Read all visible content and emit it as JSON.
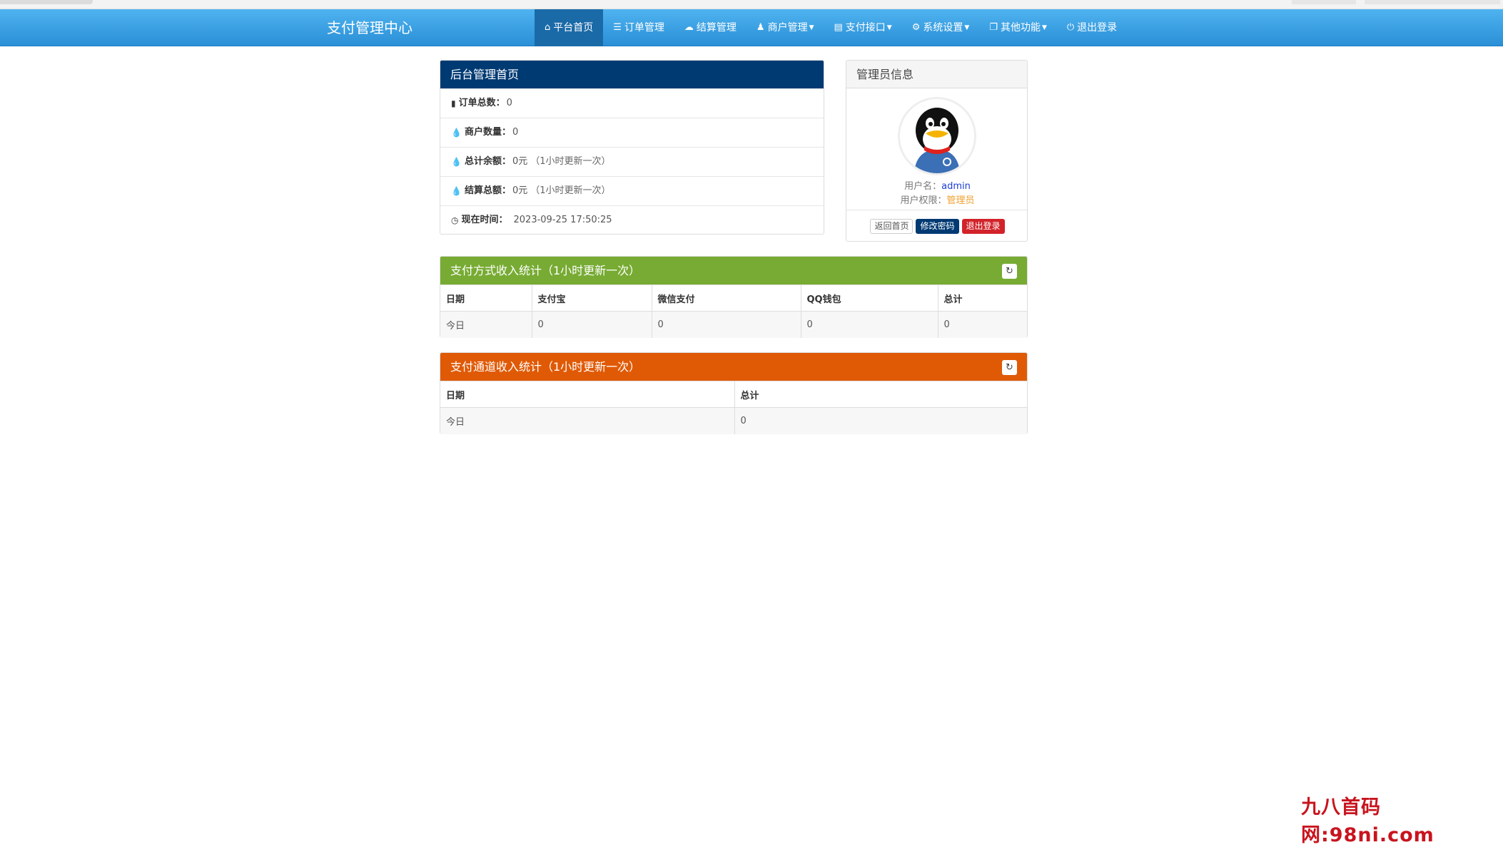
{
  "navbar": {
    "brand": "支付管理中心",
    "items": [
      {
        "label": "平台首页",
        "icon": "home-icon",
        "active": true
      },
      {
        "label": "订单管理",
        "icon": "list-icon"
      },
      {
        "label": "结算管理",
        "icon": "cloud-icon"
      },
      {
        "label": "商户管理",
        "icon": "user-icon",
        "dropdown": true
      },
      {
        "label": "支付接口",
        "icon": "credit-card-icon",
        "dropdown": true
      },
      {
        "label": "系统设置",
        "icon": "gear-icon",
        "dropdown": true
      },
      {
        "label": "其他功能",
        "icon": "cube-icon",
        "dropdown": true
      },
      {
        "label": "退出登录",
        "icon": "power-icon"
      }
    ]
  },
  "home_panel": {
    "title": "后台管理首页",
    "rows": [
      {
        "icon": "bar-chart-icon",
        "label": "订单总数：",
        "value": "0",
        "note": ""
      },
      {
        "icon": "tint-icon",
        "label": "商户数量：",
        "value": "0",
        "note": ""
      },
      {
        "icon": "tint-icon",
        "label": "总计余额：",
        "value": "0元",
        "note": "（1小时更新一次）"
      },
      {
        "icon": "tint-icon",
        "label": "结算总额：",
        "value": "0元",
        "note": "（1小时更新一次）"
      },
      {
        "icon": "clock-icon",
        "label": "现在时间：",
        "value": "2023-09-25 17:50:25",
        "note": ""
      }
    ]
  },
  "admin_panel": {
    "title": "管理员信息",
    "username_label": "用户名：",
    "username": "admin",
    "role_label": "用户权限：",
    "role": "管理员",
    "buttons": {
      "home": "返回首页",
      "change_password": "修改密码",
      "logout": "退出登录"
    },
    "colors": {
      "blue": "#003a73",
      "red": "#d2232a"
    }
  },
  "pay_method_stats": {
    "title": "支付方式收入统计（1小时更新一次）",
    "color": "#77ab33",
    "headers": [
      "日期",
      "支付宝",
      "微信支付",
      "QQ钱包",
      "总计"
    ],
    "rows": [
      [
        "今日",
        "0",
        "0",
        "0",
        "0"
      ]
    ]
  },
  "pay_channel_stats": {
    "title": "支付通道收入统计（1小时更新一次）",
    "color": "#e05a06",
    "headers": [
      "日期",
      "总计"
    ],
    "rows": [
      [
        "今日",
        "0"
      ]
    ]
  },
  "watermark": "九八首码网:98ni.com"
}
